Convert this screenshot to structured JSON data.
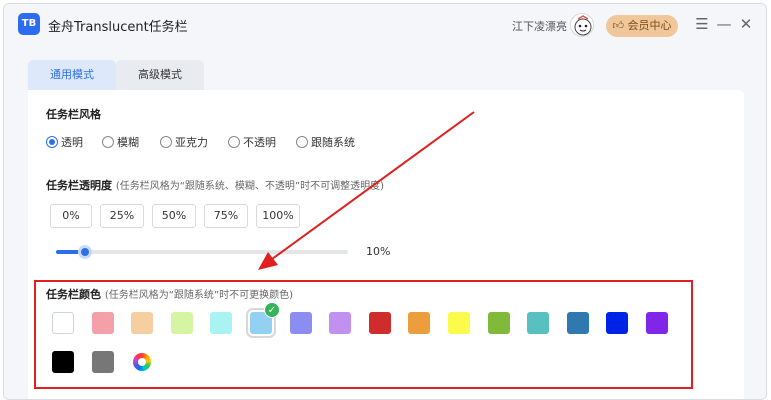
{
  "titlebar": {
    "logo_text": "TB",
    "app_title": "金舟Translucent任务栏",
    "username": "江下凌漂亮",
    "vip_label": "会员中心",
    "menu_icon": "hamburger-icon",
    "minimize_icon": "minimize-icon",
    "close_icon": "close-icon"
  },
  "tabs": [
    {
      "label": "通用模式",
      "active": true
    },
    {
      "label": "高级模式",
      "active": false
    }
  ],
  "style_section": {
    "title": "任务栏风格",
    "options": [
      {
        "label": "透明",
        "checked": true
      },
      {
        "label": "模糊",
        "checked": false
      },
      {
        "label": "亚克力",
        "checked": false
      },
      {
        "label": "不透明",
        "checked": false
      },
      {
        "label": "跟随系统",
        "checked": false
      }
    ]
  },
  "opacity_section": {
    "title": "任务栏透明度",
    "note": "(任务栏风格为“跟随系统、模糊、不透明”时不可调整透明度)",
    "presets": [
      "0%",
      "25%",
      "50%",
      "75%",
      "100%"
    ],
    "slider_value": 0.1,
    "value_label": "10%"
  },
  "color_section": {
    "title": "任务栏颜色",
    "note": "(任务栏风格为“跟随系统”时不可更换颜色)",
    "selected_index": 5,
    "colors": [
      "#ffffff",
      "#f4a0a8",
      "#f5cf9f",
      "#d6f5a3",
      "#a9f3f3",
      "#93d0f2",
      "#8b8ef0",
      "#c290ee",
      "#cf2c2c",
      "#ec9d3c",
      "#fbfb4c",
      "#7fba3a",
      "#58c0bf",
      "#2f79b0",
      "#0022e6",
      "#8125e9",
      "#000000",
      "#777777"
    ],
    "custom_icon": "color-wheel-icon"
  },
  "accent_colors": {
    "primary": "#2c6fe9",
    "highlight": "#e02020",
    "vip": "#efc79a"
  }
}
